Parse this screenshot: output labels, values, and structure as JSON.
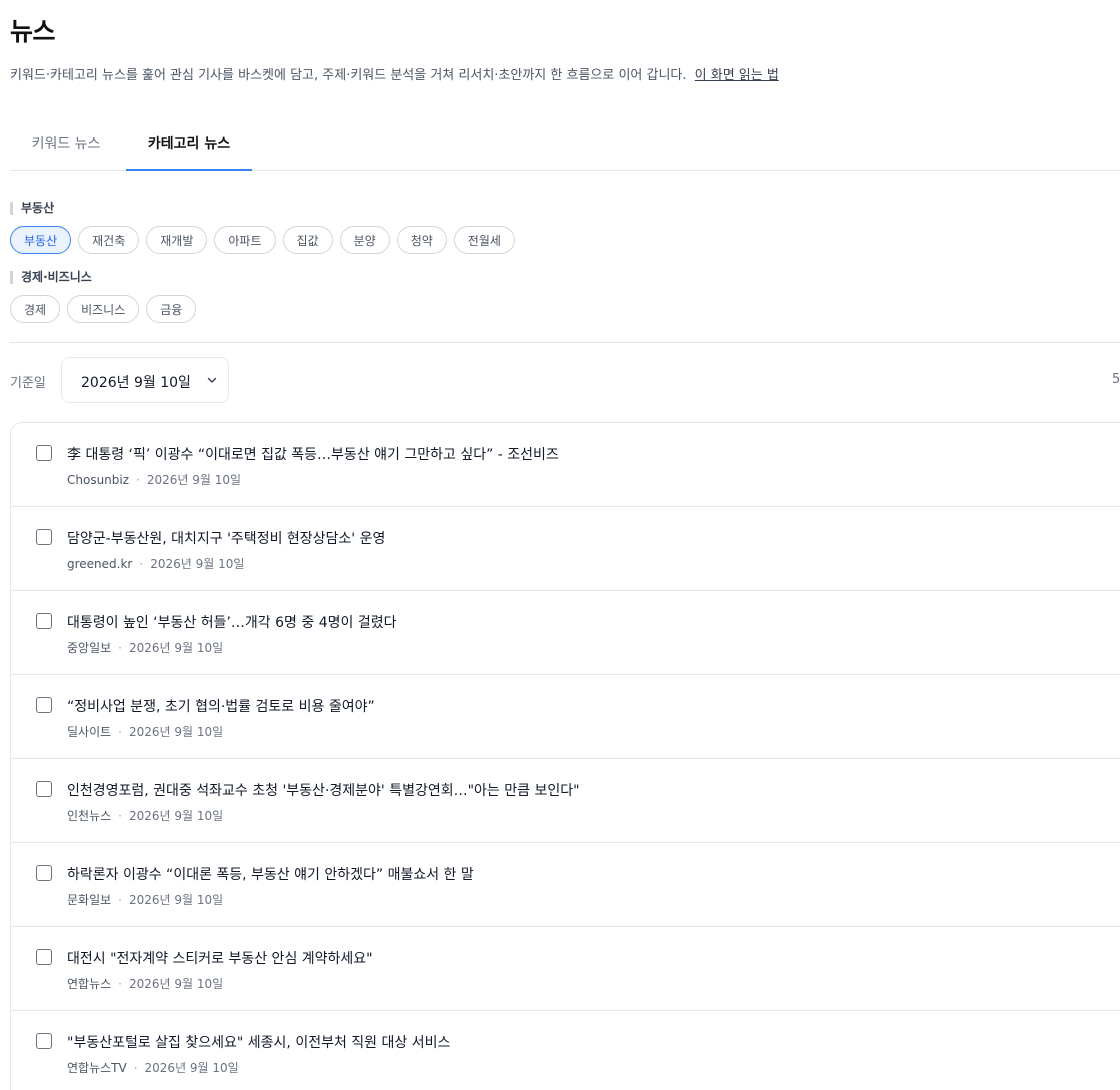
{
  "header": {
    "title": "뉴스",
    "subtitle": "키워드·카테고리 뉴스를 훑어 관심 기사를 바스켓에 담고, 주제·키워드 분석을 거쳐 리서치·초안까지 한 흐름으로 이어 갑니다.",
    "howto_link": "이 화면 읽는 법"
  },
  "tabs": [
    {
      "label": "키워드 뉴스"
    },
    {
      "label": "카테고리 뉴스"
    }
  ],
  "categories": {
    "realestate": {
      "label": "부동산",
      "chips": [
        "부동산",
        "재건축",
        "재개발",
        "아파트",
        "집값",
        "분양",
        "청약",
        "전월세"
      ]
    },
    "economy": {
      "label": "경제·비즈니스",
      "chips": [
        "경제",
        "비즈니스",
        "금융"
      ]
    }
  },
  "filter": {
    "date_label": "기준일",
    "date_value": "2026년 9월 10일",
    "right_text": "5"
  },
  "articles": [
    {
      "title": "李 대통령 ‘픽’ 이광수 “이대로면 집값 폭등…부동산 얘기 그만하고 싶다” - 조선비즈",
      "source": "Chosunbiz",
      "date": "2026년 9월 10일"
    },
    {
      "title": "담양군-부동산원, 대치지구 '주택정비 현장상담소' 운영",
      "source": "greened.kr",
      "date": "2026년 9월 10일"
    },
    {
      "title": "대통령이 높인 ‘부동산 허들’…개각 6명 중 4명이 걸렸다",
      "source": "중앙일보",
      "date": "2026년 9월 10일"
    },
    {
      "title": "“정비사업 분쟁, 초기 협의·법률 검토로 비용 줄여야”",
      "source": "딜사이트",
      "date": "2026년 9월 10일"
    },
    {
      "title": "인천경영포럼, 권대중 석좌교수 초청 '부동산·경제분야' 특별강연회…\"아는 만큼 보인다\"",
      "source": "인천뉴스",
      "date": "2026년 9월 10일"
    },
    {
      "title": "하락론자 이광수 “이대론 폭등, 부동산 얘기 안하겠다” 매불쇼서 한 말",
      "source": "문화일보",
      "date": "2026년 9월 10일"
    },
    {
      "title": "대전시 \"전자계약 스티커로 부동산 안심 계약하세요\"",
      "source": "연합뉴스",
      "date": "2026년 9월 10일"
    },
    {
      "title": "\"부동산포털로 살집 찾으세요\" 세종시, 이전부처 직원 대상 서비스",
      "source": "연합뉴스TV",
      "date": "2026년 9월 10일"
    }
  ],
  "colors": {
    "accent": "#3b82f6",
    "chip_active_bg": "#eaf2fe",
    "border": "#e5e7eb"
  }
}
